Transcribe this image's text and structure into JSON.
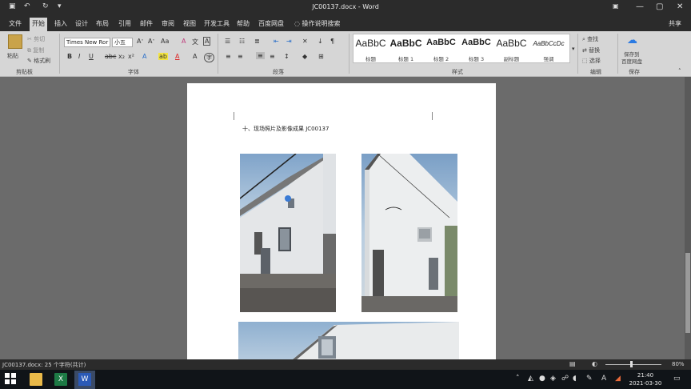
{
  "titlebar": {
    "title": "JC00137.docx  -  Word",
    "save_glyph": "▣",
    "undo_glyph": "↶",
    "redo_glyph": "↻",
    "customize_glyph": "▾",
    "options_glyph": "▣",
    "minimize_glyph": "—",
    "maximize_glyph": "▢",
    "close_glyph": "✕"
  },
  "tabs": [
    "文件",
    "开始",
    "插入",
    "设计",
    "布局",
    "引用",
    "邮件",
    "审阅",
    "视图",
    "开发工具",
    "帮助",
    "百度网盘"
  ],
  "tell_me": "操作说明搜索",
  "share": "共享",
  "ribbon": {
    "clipboard": {
      "paste": "粘贴",
      "cut": "剪切",
      "copy": "复制",
      "format_painter": "格式刷",
      "label": "剪贴板"
    },
    "font": {
      "name": "Times New Ror",
      "size": "小五",
      "label": "字体"
    },
    "paragraph": {
      "label": "段落"
    },
    "styles": {
      "label": "样式",
      "items": [
        {
          "preview": "AaBbC",
          "name": "标题"
        },
        {
          "preview": "AaBbC",
          "name": "标题 1"
        },
        {
          "preview": "AaBbC",
          "name": "标题 2"
        },
        {
          "preview": "AaBbC",
          "name": "标题 3"
        },
        {
          "preview": "AaBbC",
          "name": "副标题"
        },
        {
          "preview": "AaBbCcDc",
          "name": "强调"
        }
      ]
    },
    "editing": {
      "find": "查找",
      "replace": "替换",
      "select": "选择",
      "label": "编辑"
    },
    "save_group": {
      "btn1": "保存到",
      "btn2": "百度网盘",
      "label": "保存"
    }
  },
  "document": {
    "caption": "十、现场照片及影像成果          JC00137"
  },
  "statusbar": {
    "text": "JC00137.docx: 25 个字符(共计)",
    "zoom": "80%"
  },
  "taskbar": {
    "time": "21:40",
    "date": "2021-03-30"
  }
}
